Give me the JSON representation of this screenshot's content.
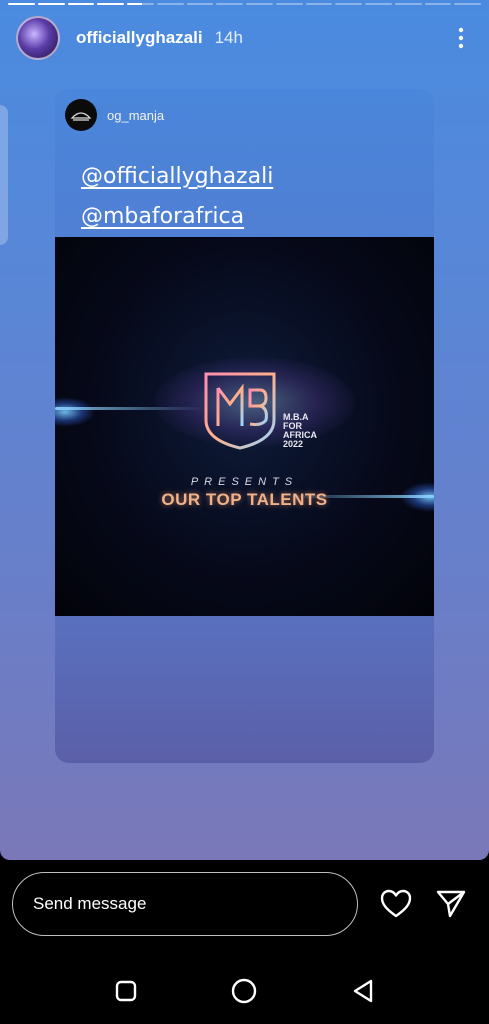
{
  "story": {
    "progress_segments": [
      1,
      1,
      1,
      1,
      0.55,
      0,
      0,
      0,
      0,
      0,
      0,
      0,
      0,
      0,
      0,
      0
    ],
    "username": "officiallyghazali",
    "time": "14h",
    "more_icon": "more-vertical-icon"
  },
  "card": {
    "username": "og_manja",
    "mentions": [
      "@officiallyghazali",
      "@mbaforafrica"
    ],
    "video": {
      "brand_lines": [
        "M.B.A",
        "FOR",
        "AFRICA",
        "2022"
      ],
      "presents": "PRESENTS",
      "headline": "OUR TOP TALENTS"
    }
  },
  "reply": {
    "placeholder": "Send message",
    "like_icon": "heart-icon",
    "share_icon": "send-icon"
  },
  "nav": {
    "recents_icon": "square-icon",
    "home_icon": "circle-icon",
    "back_icon": "triangle-back-icon"
  }
}
